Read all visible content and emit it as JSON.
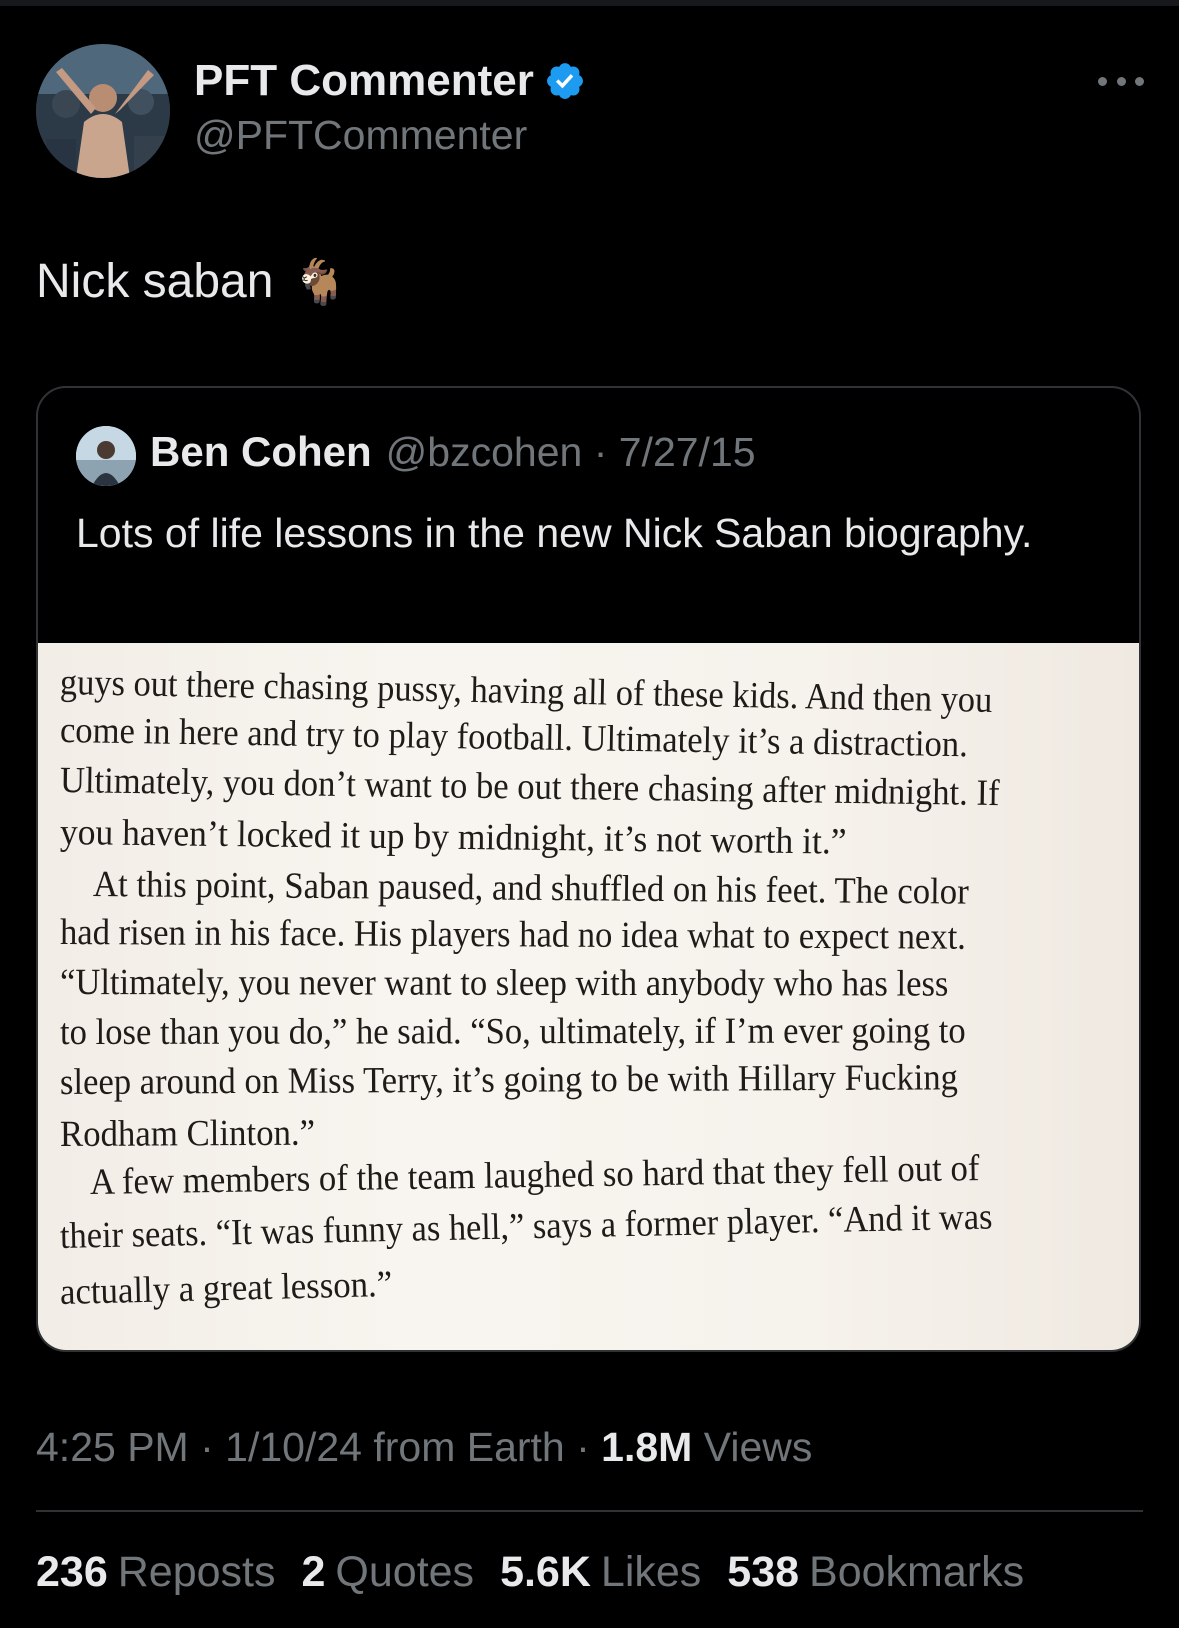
{
  "tweet": {
    "author": {
      "display_name": "PFT Commenter",
      "handle": "@PFTCommenter",
      "verified": true
    },
    "text": "Nick saban",
    "emoji": "🐐",
    "timestamp": "4:25 PM",
    "date": "1/10/24",
    "source": "from Earth",
    "views_count": "1.8M",
    "views_label": "Views",
    "stats": {
      "reposts_count": "236",
      "reposts_label": "Reposts",
      "quotes_count": "2",
      "quotes_label": "Quotes",
      "likes_count": "5.6K",
      "likes_label": "Likes",
      "bookmarks_count": "538",
      "bookmarks_label": "Bookmarks"
    }
  },
  "quoted_tweet": {
    "display_name": "Ben Cohen",
    "handle": "@bzcohen",
    "date": "7/27/15",
    "text": "Lots of life lessons in the new Nick Saban biography.",
    "book_page_lines": [
      "guys out there chasing pussy, having all of these kids. And then you",
      "come in here and try to play football. Ultimately it’s a distraction.",
      "Ultimately, you don’t want to be out there chasing after midnight. If",
      "you haven’t locked it up by midnight, it’s not worth it.”",
      "At this point, Saban paused, and shuffled on his feet. The color",
      "had risen in his face. His players had no idea what to expect next.",
      "“Ultimately, you never want to sleep with anybody who has less",
      "to lose than you do,” he said. “So, ultimately, if I’m ever going to",
      "sleep around on Miss Terry, it’s going to be with Hillary Fucking",
      "Rodham Clinton.”",
      "A few members of the team laughed so hard that they fell out of",
      "their seats. “It was funny as hell,” says a former player. “And it was",
      "actually a great lesson.”"
    ]
  },
  "ui": {
    "verified_icon": "verified-badge-icon",
    "more_icon": "more-options-icon",
    "accent_color": "#1d9bf0",
    "background_color": "#000000",
    "secondary_text_color": "#71767b"
  }
}
